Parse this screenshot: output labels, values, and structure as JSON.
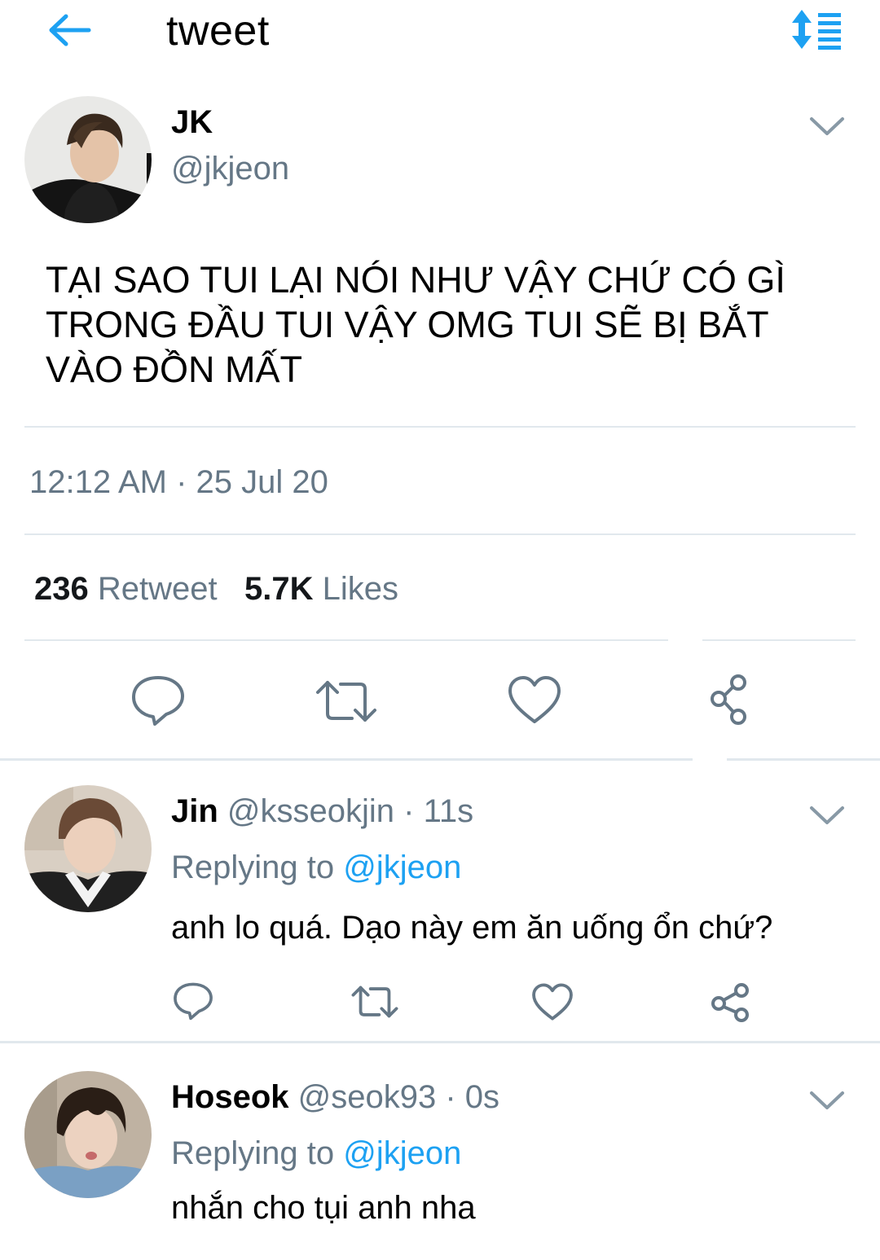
{
  "colors": {
    "accent": "#1da1f2",
    "muted_text": "#657786",
    "divider": "#e1e8ed",
    "icon_gray": "#8899a6"
  },
  "header": {
    "title": "tweet",
    "back_icon": "back-arrow-icon",
    "sort_icon": "sort-icon"
  },
  "main_tweet": {
    "name": "JK",
    "handle": "@jkjeon",
    "text": "TẠI SAO TUI LẠI NÓI NHƯ VẬY CHỨ CÓ GÌ TRONG ĐẦU TUI VẬY OMG TUI SẼ BỊ BẮT VÀO ĐỒN MẤT",
    "timestamp": "12:12 AM · 25 Jul 20",
    "stats": {
      "retweets_count": "236",
      "retweets_label": "Retweet",
      "likes_count": "5.7K",
      "likes_label": "Likes"
    },
    "actions": [
      "reply-icon",
      "retweet-icon",
      "like-icon",
      "share-icon"
    ]
  },
  "replies": [
    {
      "name": "Jin",
      "handle": "@ksseokjin",
      "time": "· 11s",
      "replying_prefix": "Replying to",
      "replying_to": "@jkjeon",
      "text": "anh lo quá. Dạo này em ăn uống ổn chứ?"
    },
    {
      "name": "Hoseok",
      "handle": "@seok93",
      "time": "· 0s",
      "replying_prefix": "Replying to",
      "replying_to": "@jkjeon",
      "text": "nhắn cho tụi anh nha"
    }
  ]
}
